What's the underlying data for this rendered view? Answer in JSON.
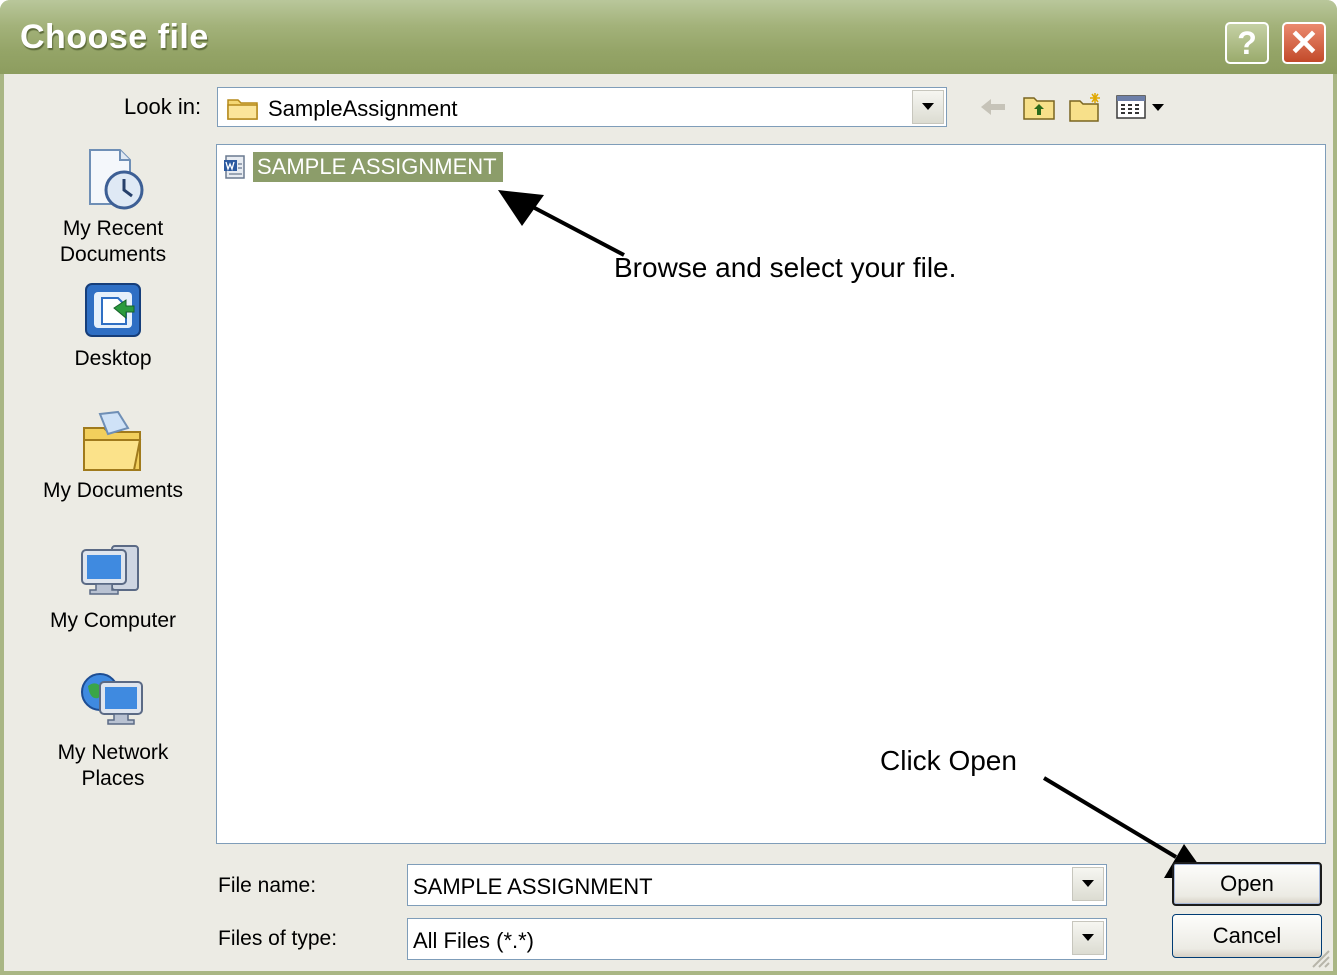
{
  "window": {
    "title": "Choose file"
  },
  "title_buttons": {
    "help": "?",
    "close": "✕"
  },
  "lookin": {
    "label": "Look in:",
    "value": "SampleAssignment"
  },
  "toolbar_icons": [
    "back-arrow-icon",
    "up-folder-icon",
    "new-folder-icon",
    "views-menu-icon"
  ],
  "places": [
    {
      "id": "recent",
      "label_lines": [
        "My Recent",
        "Documents"
      ],
      "icon": "recent-documents-icon"
    },
    {
      "id": "desktop",
      "label_lines": [
        "Desktop"
      ],
      "icon": "desktop-icon"
    },
    {
      "id": "documents",
      "label_lines": [
        "My Documents"
      ],
      "icon": "my-documents-icon"
    },
    {
      "id": "computer",
      "label_lines": [
        "My Computer"
      ],
      "icon": "my-computer-icon"
    },
    {
      "id": "network",
      "label_lines": [
        "My Network",
        "Places"
      ],
      "icon": "network-places-icon"
    }
  ],
  "files": [
    {
      "name": "SAMPLE ASSIGNMENT",
      "icon": "word-document-icon",
      "selected": true
    }
  ],
  "annotations": {
    "browse": "Browse and select your file.",
    "click_open": "Click Open"
  },
  "filename": {
    "label": "File name:",
    "value": "SAMPLE ASSIGNMENT"
  },
  "filetype": {
    "label": "Files of type:",
    "value": "All Files (*.*)"
  },
  "buttons": {
    "open": "Open",
    "cancel": "Cancel"
  },
  "colors": {
    "titlebar": "#94a467",
    "selection": "#8c9d6a",
    "frame": "#ecebe4"
  }
}
